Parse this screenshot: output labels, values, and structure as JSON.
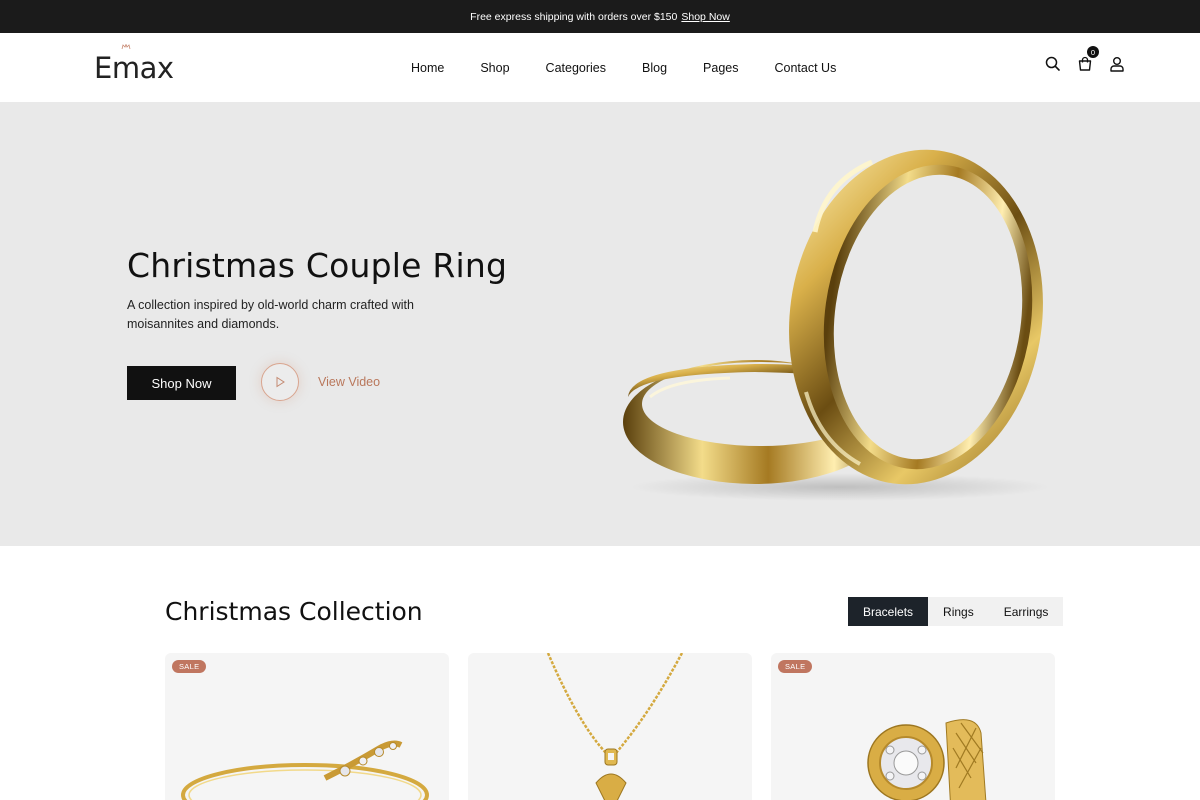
{
  "topbar": {
    "message": "Free express shipping with orders over $150",
    "link_label": "Shop Now"
  },
  "header": {
    "logo": "Emax",
    "nav": [
      "Home",
      "Shop",
      "Categories",
      "Blog",
      "Pages",
      "Contact Us"
    ],
    "cart_count": "0",
    "icons": [
      "search-icon",
      "cart-icon",
      "user-icon"
    ]
  },
  "hero": {
    "title": "Christmas Couple Ring",
    "subtitle": "A collection inspired by old-world charm crafted with moisannites and diamonds.",
    "primary_button": "Shop Now",
    "video_label": "View Video"
  },
  "collection": {
    "title": "Christmas Collection",
    "tabs": [
      {
        "label": "Bracelets",
        "active": true
      },
      {
        "label": "Rings",
        "active": false
      },
      {
        "label": "Earrings",
        "active": false
      }
    ],
    "products": [
      {
        "badge": "SALE"
      },
      {
        "badge": ""
      },
      {
        "badge": "SALE"
      }
    ]
  },
  "colors": {
    "topbar_bg": "#1b1b1b",
    "hero_bg": "#e9e9e9",
    "accent": "#b9775b",
    "sale_badge": "#c07660",
    "active_tab": "#1d232a",
    "gold": "#d4a93f"
  }
}
